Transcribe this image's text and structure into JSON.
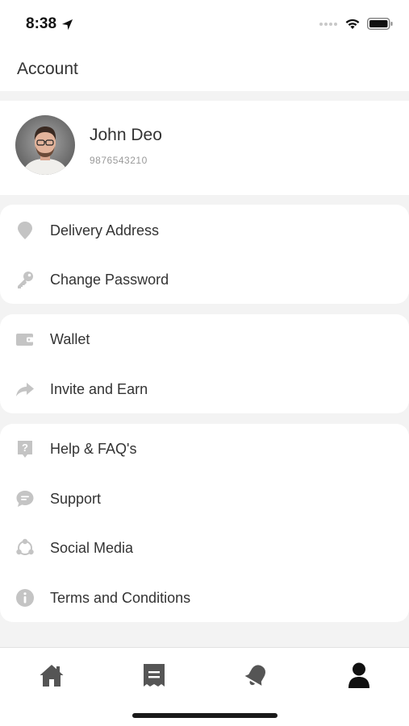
{
  "status_bar": {
    "time": "8:38"
  },
  "header": {
    "title": "Account"
  },
  "profile": {
    "name": "John Deo",
    "phone": "9876543210"
  },
  "groups": [
    {
      "items": [
        {
          "label": "Delivery Address",
          "icon": "location-pin-icon"
        },
        {
          "label": "Change Password",
          "icon": "key-icon"
        }
      ]
    },
    {
      "items": [
        {
          "label": "Wallet",
          "icon": "wallet-icon"
        },
        {
          "label": "Invite and Earn",
          "icon": "share-arrow-icon"
        }
      ]
    },
    {
      "items": [
        {
          "label": "Help & FAQ's",
          "icon": "help-icon"
        },
        {
          "label": "Support",
          "icon": "chat-icon"
        },
        {
          "label": "Social Media",
          "icon": "social-icon"
        },
        {
          "label": "Terms and Conditions",
          "icon": "info-icon"
        }
      ]
    }
  ],
  "bottom_nav": [
    {
      "icon": "home-icon"
    },
    {
      "icon": "receipt-icon"
    },
    {
      "icon": "bell-icon"
    },
    {
      "icon": "profile-icon",
      "active": true
    }
  ],
  "colors": {
    "icon_gray": "#c4c4c4",
    "nav_active": "#111111",
    "nav_inactive": "#555555"
  }
}
